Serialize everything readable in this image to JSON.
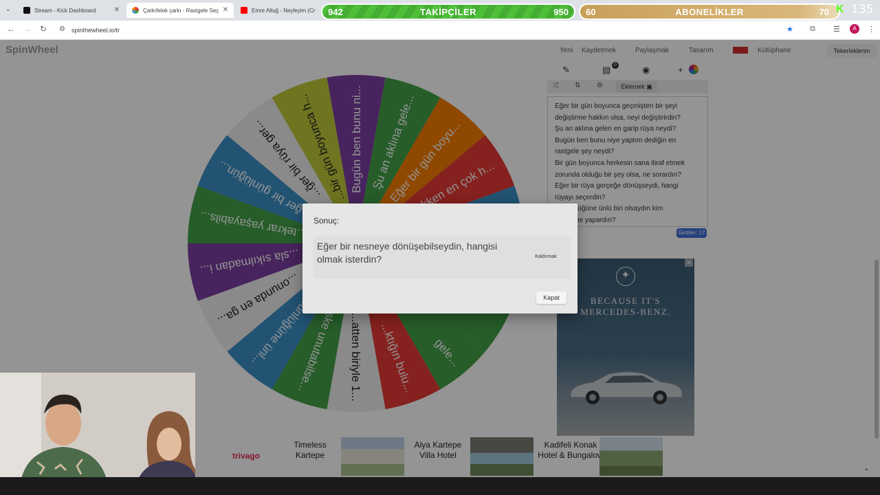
{
  "browser": {
    "tabs": [
      {
        "title": "Stream - Kick Dashboard",
        "color": "#53fc18"
      },
      {
        "title": "Çarkıfelek çarkı - Rastgele Seçi",
        "color": "#e53935"
      },
      {
        "title": "Emre Altuğ - Neyleyim (Cr",
        "color": "#ff0000"
      }
    ],
    "url": "spinthewheel.io/tr"
  },
  "overlay": {
    "followers": {
      "left": "942",
      "label": "TAKİPÇİLER",
      "right": "950"
    },
    "subs": {
      "left": "60",
      "label": "ABONELİKLER",
      "right": "70"
    },
    "kick_count": "135"
  },
  "site": {
    "logo": "SpinWheel",
    "nav": [
      "Yeni",
      "Kaydetmek",
      "Paylaşmak",
      "Tasarım",
      "Kütüphane"
    ],
    "lists_button": "Tekerleklerim"
  },
  "wheel": {
    "segments": [
      {
        "label": "Bugün ben bunu ni...",
        "color": "#7b3fa0"
      },
      {
        "label": "Şu an aklına gele...",
        "color": "#43a047"
      },
      {
        "label": "Eğer bir gün boyu...",
        "color": "#f57c00"
      },
      {
        "label": "...kken en çok h...",
        "color": "#e53935"
      },
      {
        "label": "",
        "color": "#3b8fc7"
      },
      {
        "label": "",
        "color": "#7b3fa0"
      },
      {
        "label": "",
        "color": "#43a047"
      },
      {
        "label": "gele...",
        "color": "#43a047"
      },
      {
        "label": "...ktığın bulu...",
        "color": "#e53935"
      },
      {
        "label": "...atten biriyle 1...",
        "color": "#eeeeee"
      },
      {
        "label": "...ske unutabilse...",
        "color": "#43a047"
      },
      {
        "label": "...ünlüğüne ünl...",
        "color": "#3b8fc7"
      },
      {
        "label": "...onunda en ga...",
        "color": "#eeeeee"
      },
      {
        "label": "...sla sıkılmadan i...",
        "color": "#7b3fa0"
      },
      {
        "label": "...tekrar yaşayabils...",
        "color": "#43a047"
      },
      {
        "label": "...ğer bir günlüğün...",
        "color": "#3b8fc7"
      },
      {
        "label": "...ğer bir rüya ger...",
        "color": "#eeeeee"
      },
      {
        "label": "...bir gün boyunca h...",
        "color": "#c0c83a"
      }
    ]
  },
  "panel": {
    "add_image": "Eklemek",
    "entries": [
      "Eğer bir gün boyunca geçmişten bir şeyi",
      "değiştirme hakkın olsa, neyi değiştirirdin?",
      "Şu an aklına gelen en garip rüya neydi?",
      "Bugün ben bunu niye yaptım dediğin en",
      "rastgele şey neydi?",
      "Bir gün boyunca herkesin sana itiraf etmek",
      "zorunda olduğu bir şey olsa, ne sorardın?",
      "Eğer bir rüya gerçeğe dönüşseydi, hangi",
      "rüyayı seçerdin?",
      "...r günlüğüne ünlü biri olsaydın kim",
      "...n ve ne yapardın?"
    ],
    "entries_count": "Girdiler: 17",
    "badge_count": "0"
  },
  "ad": {
    "line1": "BECAUSE IT'S",
    "line2": "MERCEDES-BENZ."
  },
  "hotel_ad": {
    "brand": "trivago",
    "hotels": [
      {
        "name": "Timeless Kartepe"
      },
      {
        "name": "Alya Kartepe Villa Hotel"
      },
      {
        "name": "Kadifeli Konak Hotel & Bungalow"
      }
    ]
  },
  "modal": {
    "title": "Sonuç:",
    "result": "Eğer bir nesneye dönüşebilseydin, hangisi olmak isterdin?",
    "remove_label": "Kaldırmak",
    "close_label": "Kapat"
  }
}
